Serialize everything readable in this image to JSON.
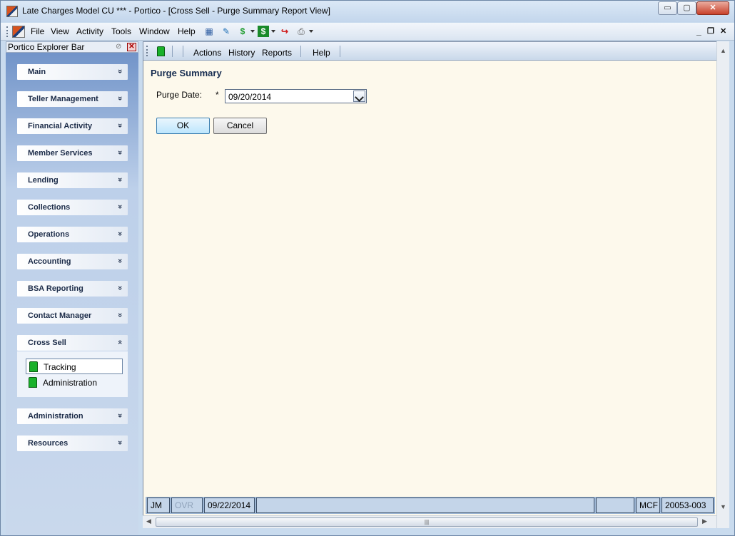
{
  "window": {
    "title": "Late Charges Model CU *** - Portico - [Cross Sell - Purge Summary Report View]",
    "min_glyph": "▭",
    "max_glyph": "▢",
    "close_glyph": "✕"
  },
  "menubar": {
    "items": [
      "File",
      "View",
      "Activity",
      "Tools",
      "Window",
      "Help"
    ],
    "mdi_min": "_",
    "mdi_restore": "❐",
    "mdi_close": "✕",
    "tool_glyphs": [
      "▦",
      "✎",
      "$",
      "$",
      "↪",
      "⎙"
    ]
  },
  "explorer": {
    "title": "Portico Explorer Bar",
    "close_glyph": "✕",
    "pin_glyph": "⊘",
    "groups": [
      {
        "label": "Main",
        "chevron": "»"
      },
      {
        "label": "Teller Management",
        "chevron": "»"
      },
      {
        "label": "Financial Activity",
        "chevron": "»"
      },
      {
        "label": "Member Services",
        "chevron": "»"
      },
      {
        "label": "Lending",
        "chevron": "»"
      },
      {
        "label": "Collections",
        "chevron": "»"
      },
      {
        "label": "Operations",
        "chevron": "»"
      },
      {
        "label": "Accounting",
        "chevron": "»"
      },
      {
        "label": "BSA Reporting",
        "chevron": "»"
      },
      {
        "label": "Contact Manager",
        "chevron": "»"
      },
      {
        "label": "Cross Sell",
        "chevron": "«"
      },
      {
        "label": "Administration",
        "chevron": "»"
      },
      {
        "label": "Resources",
        "chevron": "»"
      }
    ],
    "cross_sell_items": [
      "Tracking",
      "Administration"
    ]
  },
  "toolbar": {
    "items": [
      "Actions",
      "History",
      "Reports",
      "Help"
    ]
  },
  "form": {
    "title": "Purge Summary",
    "purge_date_label": "Purge Date:",
    "required_mark": "*",
    "purge_date_value": "09/20/2014",
    "ok_label": "OK",
    "cancel_label": "Cancel"
  },
  "statusbar": {
    "user": "JM",
    "ovr": "OVR",
    "date": "09/22/2014",
    "blank1": "",
    "blank2": "",
    "mcf": "MCF",
    "code": "20053-003"
  },
  "scroll": {
    "up": "▲",
    "down": "▼",
    "left": "◀",
    "right": "▶",
    "thumb_grip": "|||"
  }
}
